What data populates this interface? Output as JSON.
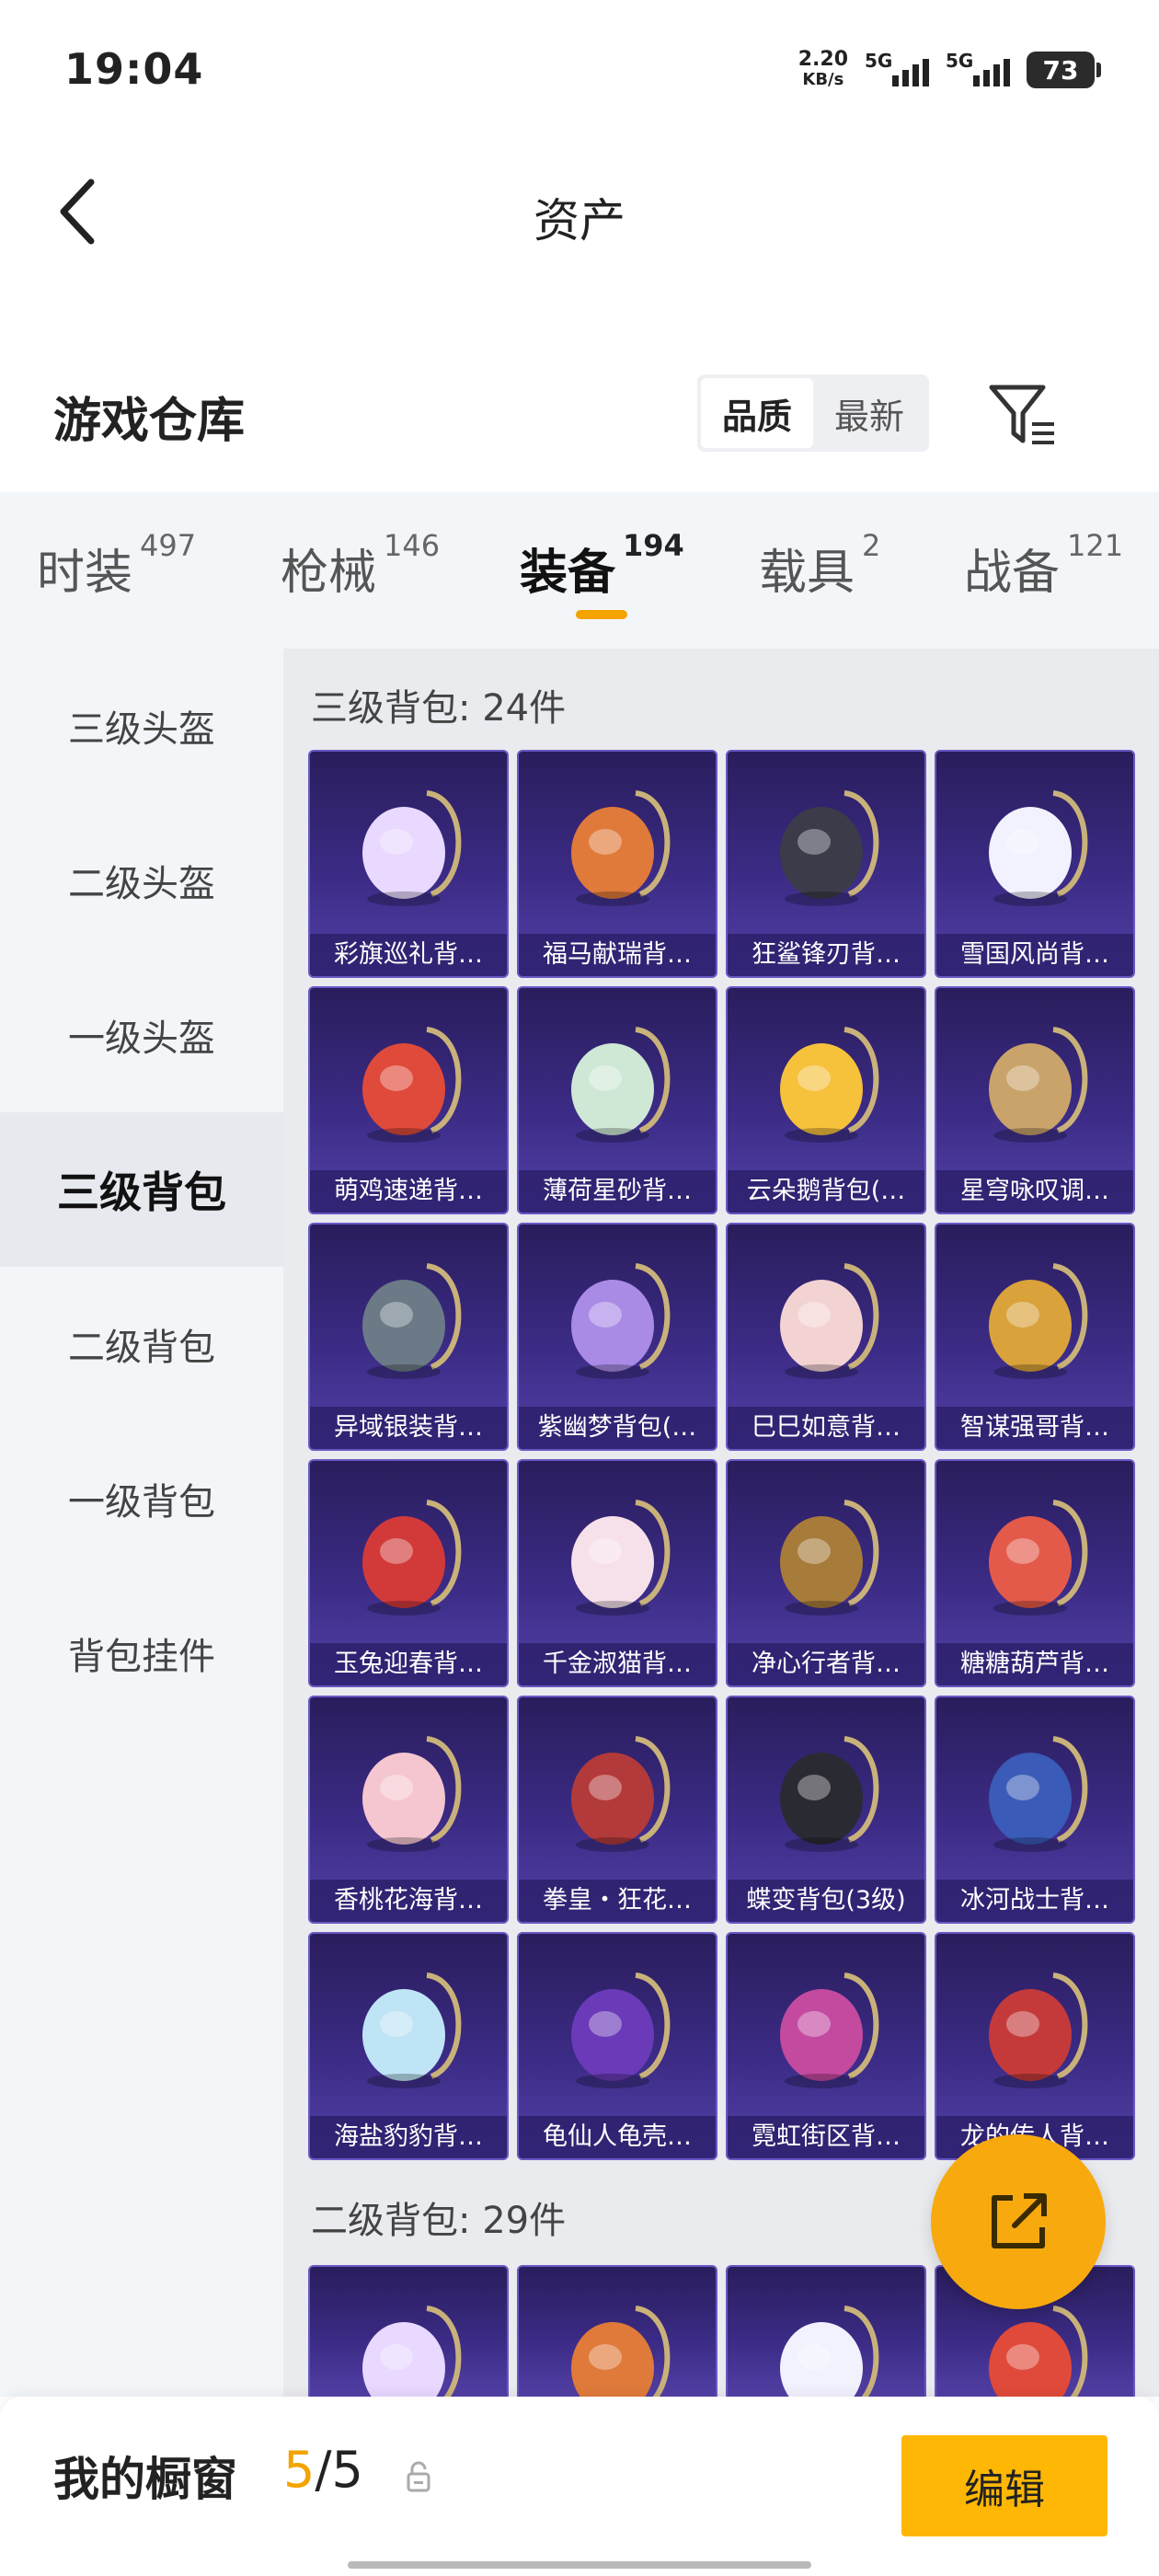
{
  "status": {
    "time": "19:04",
    "speed_value": "2.20",
    "speed_unit": "KB/s",
    "sig1": "5G",
    "sig2": "5G",
    "battery": "73"
  },
  "header": {
    "title": "资产"
  },
  "section": {
    "title": "游戏仓库",
    "sort_options": [
      "品质",
      "最新"
    ],
    "sort_selected": "品质"
  },
  "tabs": [
    {
      "label": "时装",
      "count": "497"
    },
    {
      "label": "枪械",
      "count": "146"
    },
    {
      "label": "装备",
      "count": "194",
      "active": true
    },
    {
      "label": "载具",
      "count": "2"
    },
    {
      "label": "战备",
      "count": "121"
    }
  ],
  "sidebar": {
    "items": [
      "三级头盔",
      "二级头盔",
      "一级头盔",
      "三级背包",
      "二级背包",
      "一级背包",
      "背包挂件"
    ],
    "active_index": 3
  },
  "groups": [
    {
      "title": "三级背包: 24件",
      "items": [
        "彩旗巡礼背…",
        "福马献瑞背…",
        "狂鲨锋刃背…",
        "雪国风尚背…",
        "萌鸡速递背…",
        "薄荷星砂背…",
        "云朵鹅背包(…",
        "星穹咏叹调…",
        "异域银装背…",
        "紫幽梦背包(…",
        "巳巳如意背…",
        "智谋强哥背…",
        "玉兔迎春背…",
        "千金淑猫背…",
        "净心行者背…",
        "糖糖葫芦背…",
        "香桃花海背…",
        "拳皇・狂花…",
        "蝶变背包(3级)",
        "冰河战士背…",
        "海盐豹豹背…",
        "龟仙人龟壳…",
        "霓虹街区背…",
        "龙的传人背…"
      ]
    },
    {
      "title": "二级背包: 29件"
    }
  ],
  "bottom": {
    "label": "我的橱窗",
    "current": "5",
    "total": "/5",
    "edit": "编辑"
  },
  "colors": {
    "accent": "#f4a300",
    "button": "#ffb705",
    "card_top": "#2a1d5c",
    "card_bottom": "#5441a8"
  }
}
